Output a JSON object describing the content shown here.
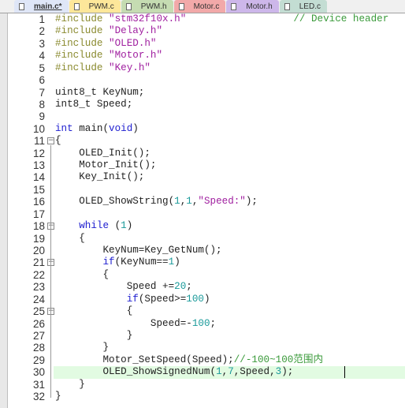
{
  "tabs": [
    {
      "label": "main.c*",
      "color": "#dfe6f7",
      "active": true
    },
    {
      "label": "PWM.c",
      "color": "#fde79a"
    },
    {
      "label": "PWM.h",
      "color": "#c5dcb2"
    },
    {
      "label": "Motor.c",
      "color": "#f2a9a9"
    },
    {
      "label": "Motor.h",
      "color": "#cdb7ea"
    },
    {
      "label": "LED.c",
      "color": "#c3ddd3"
    }
  ],
  "editor": {
    "current_line": 30,
    "fold_lines": [
      11,
      18,
      21,
      25
    ],
    "lines": [
      [
        [
          "pp",
          "#include "
        ],
        [
          "str",
          "\"stm32f10x.h\""
        ],
        [
          "",
          "                  "
        ],
        [
          "cm",
          "// Device header"
        ]
      ],
      [
        [
          "pp",
          "#include "
        ],
        [
          "str",
          "\"Delay.h\""
        ]
      ],
      [
        [
          "pp",
          "#include "
        ],
        [
          "str",
          "\"OLED.h\""
        ]
      ],
      [
        [
          "pp",
          "#include "
        ],
        [
          "str",
          "\"Motor.h\""
        ]
      ],
      [
        [
          "pp",
          "#include "
        ],
        [
          "str",
          "\"Key.h\""
        ]
      ],
      [],
      [
        [
          "",
          "uint8_t KeyNum;"
        ]
      ],
      [
        [
          "",
          "int8_t Speed;"
        ]
      ],
      [],
      [
        [
          "kw",
          "int"
        ],
        [
          "",
          " main("
        ],
        [
          "kw",
          "void"
        ],
        [
          "",
          ")"
        ]
      ],
      [
        [
          "",
          "{"
        ]
      ],
      [
        [
          "",
          "    OLED_Init();"
        ]
      ],
      [
        [
          "",
          "    Motor_Init();"
        ]
      ],
      [
        [
          "",
          "    Key_Init();"
        ]
      ],
      [],
      [
        [
          "",
          "    OLED_ShowString("
        ],
        [
          "num",
          "1"
        ],
        [
          "",
          ","
        ],
        [
          "num",
          "1"
        ],
        [
          "",
          ","
        ],
        [
          "str",
          "\"Speed:\""
        ],
        [
          "",
          ");"
        ]
      ],
      [],
      [
        [
          "",
          "    "
        ],
        [
          "kw",
          "while"
        ],
        [
          "",
          " ("
        ],
        [
          "num",
          "1"
        ],
        [
          "",
          ")"
        ]
      ],
      [
        [
          "",
          "    {"
        ]
      ],
      [
        [
          "",
          "        KeyNum=Key_GetNum();"
        ]
      ],
      [
        [
          "",
          "        "
        ],
        [
          "kw",
          "if"
        ],
        [
          "",
          "(KeyNum=="
        ],
        [
          "num",
          "1"
        ],
        [
          "",
          ")"
        ]
      ],
      [
        [
          "",
          "        {"
        ]
      ],
      [
        [
          "",
          "            Speed +="
        ],
        [
          "num",
          "20"
        ],
        [
          "",
          ";"
        ]
      ],
      [
        [
          "",
          "            "
        ],
        [
          "kw",
          "if"
        ],
        [
          "",
          "(Speed>="
        ],
        [
          "num",
          "100"
        ],
        [
          "",
          ")"
        ]
      ],
      [
        [
          "",
          "            {"
        ]
      ],
      [
        [
          "",
          "                Speed=-"
        ],
        [
          "num",
          "100"
        ],
        [
          "",
          ";"
        ]
      ],
      [
        [
          "",
          "            }"
        ]
      ],
      [
        [
          "",
          "        }"
        ]
      ],
      [
        [
          "",
          "        Motor_SetSpeed(Speed);"
        ],
        [
          "cm",
          "//-100~100范围内"
        ]
      ],
      [
        [
          "",
          "        OLED_ShowSignedNum("
        ],
        [
          "num",
          "1"
        ],
        [
          "",
          ","
        ],
        [
          "num",
          "7"
        ],
        [
          "",
          ",Speed,"
        ],
        [
          "num",
          "3"
        ],
        [
          "",
          ");"
        ]
      ],
      [
        [
          "",
          "    }"
        ]
      ],
      [
        [
          "",
          "}"
        ]
      ]
    ]
  }
}
